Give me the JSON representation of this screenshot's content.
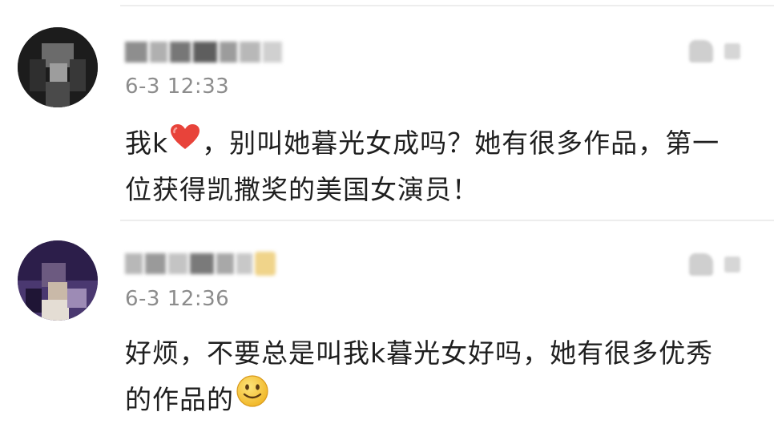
{
  "comments": [
    {
      "timestamp": "6-3 12:33",
      "content_line1_before": "我k",
      "content_line1_after": "，别叫她暮光女成吗？她有很多作品，第一",
      "content_line2": "位获得凯撒奖的美国女演员！",
      "inline_icon": "red-heart-icon"
    },
    {
      "timestamp": "6-3 12:36",
      "content_line1": "好烦，不要总是叫我k暮光女好吗，她有很多优秀",
      "content_line2_before": "的作品的",
      "inline_icon": "smiley-face-icon"
    }
  ],
  "colors": {
    "timestamp": "#8c8c8c",
    "text": "#1f1f1f",
    "heart": "#e8433a",
    "smiley": "#f7c53b"
  }
}
